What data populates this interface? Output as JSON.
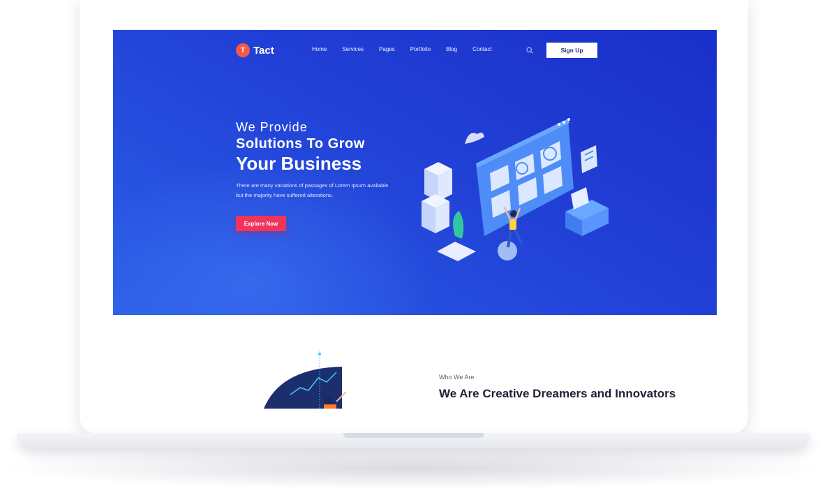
{
  "brand": {
    "logo_letter": "T",
    "name": "Tact",
    "accent": "#f4594b"
  },
  "nav": {
    "items": [
      "Home",
      "Services",
      "Pages",
      "Portfolio",
      "Blog",
      "Contact"
    ]
  },
  "header": {
    "search_icon": "search-icon",
    "signup_label": "Sign Up"
  },
  "hero": {
    "line1": "We Provide",
    "line2": "Solutions To Grow",
    "line3": "Your Business",
    "description": "There are many variations of passages of Lorem Ipsum available but the majority have suffered alterations.",
    "cta_label": "Explore Now",
    "cta_color": "#f0345b",
    "bg_color": "#2140d6"
  },
  "about": {
    "eyebrow": "Who We Are",
    "title": "We Are Creative Dreamers and Innovators"
  }
}
